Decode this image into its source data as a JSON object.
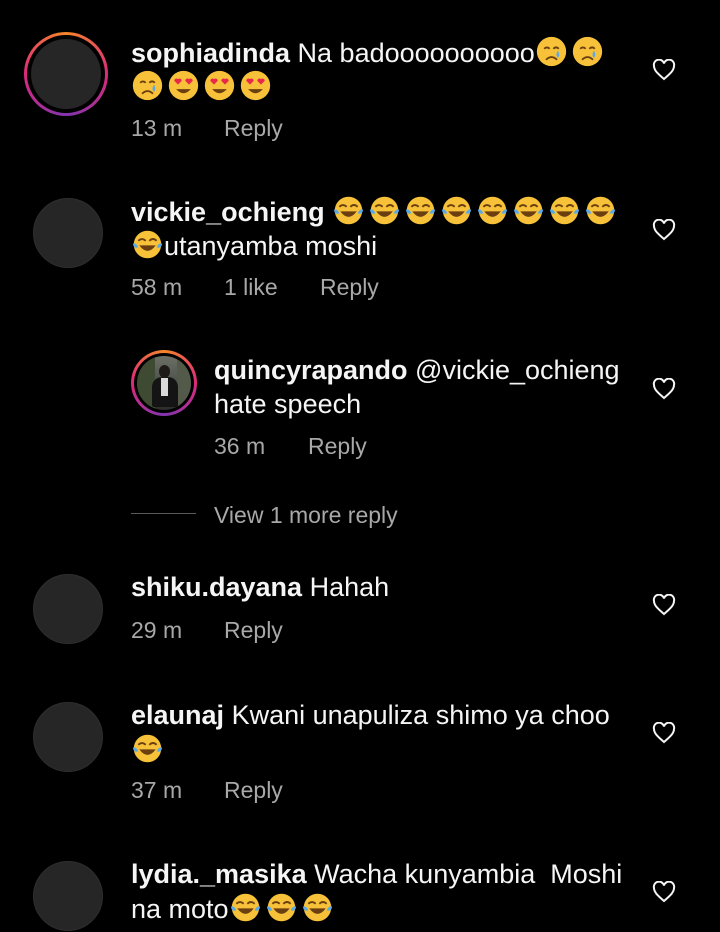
{
  "comments": [
    {
      "username": "sophiadinda",
      "text_line1": "Na badoooooooooo",
      "text_line2": "",
      "emojis_line1": [
        "crying-face",
        "crying-face"
      ],
      "emojis_line2": [
        "crying-face",
        "heart-eyes",
        "heart-eyes",
        "heart-eyes"
      ],
      "time": "13 m",
      "likes": "",
      "reply": "Reply"
    },
    {
      "username": "vickie_ochieng",
      "text_line1": "",
      "text_line2": "utanyamba moshi",
      "emojis_line1": [
        "tears-of-joy",
        "tears-of-joy",
        "tears-of-joy",
        "tears-of-joy",
        "tears-of-joy",
        "tears-of-joy",
        "tears-of-joy",
        "tears-of-joy"
      ],
      "emojis_line2": [
        "tears-of-joy"
      ],
      "time": "58 m",
      "likes": "1 like",
      "reply": "Reply"
    },
    {
      "username": "quincyrapando",
      "mention": "@vickie_ochieng",
      "text_line2": "hate speech",
      "time": "36 m",
      "reply": "Reply"
    },
    {
      "username": "shiku.dayana",
      "text_line1": "Hahah",
      "time": "29 m",
      "reply": "Reply"
    },
    {
      "username": "elaunaj",
      "text_line1": "Kwani unapuliza shimo ya choo",
      "emojis_line2": [
        "tears-of-joy"
      ],
      "time": "37 m",
      "reply": "Reply"
    },
    {
      "username": "lydia._masika",
      "text_line1": "Wacha kunyambia  Moshi",
      "text_line2": "na moto",
      "emojis_line2": [
        "tears-of-joy",
        "tears-of-joy",
        "tears-of-joy"
      ]
    }
  ],
  "view_more_replies": "View 1 more reply",
  "icons": {
    "like": "heart-outline-icon"
  },
  "colors": {
    "background": "#000000",
    "text": "#f5f5f5",
    "secondary": "#a8a8a8",
    "avatar_placeholder": "#262626"
  }
}
